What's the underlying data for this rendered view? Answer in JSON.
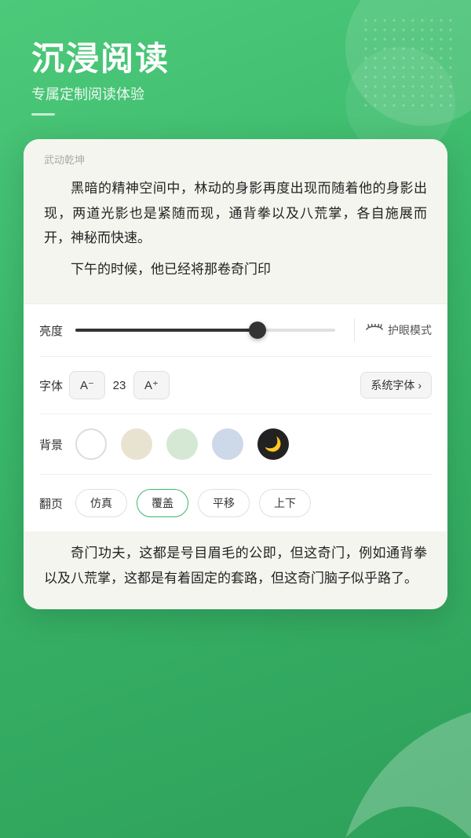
{
  "header": {
    "title": "沉浸阅读",
    "subtitle": "专属定制阅读体验"
  },
  "book": {
    "title": "武动乾坤",
    "content_para1": "黑暗的精神空间中，林动的身影再度出现而随着他的身影出现，两道光影也是紧随而现，通背拳以及八荒掌，各自施展而开，神秘而快速。",
    "content_para2": "下午的时候，他已经将那卷奇门印",
    "bottom_para": "奇门功夫，这都是号目眉毛的公即，但这奇门，例如通背拳以及八荒掌，这都是有着固定的套路，但这奇门脑子似乎路了。"
  },
  "settings": {
    "brightness_label": "亮度",
    "brightness_value": 70,
    "eye_mode_label": "护眼模式",
    "font_label": "字体",
    "font_decrease": "A⁻",
    "font_size": "23",
    "font_increase": "A⁺",
    "font_family": "系统字体",
    "font_family_arrow": "›",
    "bg_label": "背景",
    "flip_label": "翻页",
    "flip_options": [
      "仿真",
      "覆盖",
      "平移",
      "上下"
    ],
    "flip_active": "覆盖"
  }
}
